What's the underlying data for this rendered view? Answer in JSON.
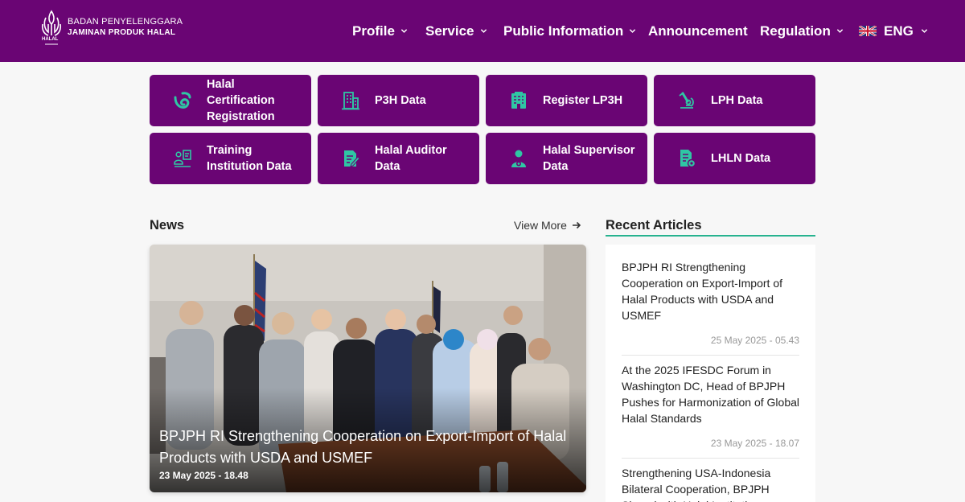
{
  "header": {
    "logo_line1": "BADAN PENYELENGGARA",
    "logo_line2": "JAMINAN PRODUK HALAL",
    "logo_small": "HALAL",
    "nav": {
      "profile": "Profile",
      "service": "Service",
      "public_information": "Public Information",
      "announcement": "Announcement",
      "regulation": "Regulation",
      "language": "ENG"
    }
  },
  "tiles": [
    {
      "label": "Halal Certification Registration",
      "icon": "halal-swirl-icon"
    },
    {
      "label": "P3H Data",
      "icon": "building-icon"
    },
    {
      "label": "Register LP3H",
      "icon": "office-building-icon"
    },
    {
      "label": "LPH Data",
      "icon": "microscope-icon"
    },
    {
      "label": "Training Institution Data",
      "icon": "presenter-icon"
    },
    {
      "label": "Halal Auditor Data",
      "icon": "document-edit-icon"
    },
    {
      "label": "Halal Supervisor Data",
      "icon": "supervisor-badge-icon"
    },
    {
      "label": "LHLN Data",
      "icon": "document-gear-icon"
    }
  ],
  "news": {
    "title": "News",
    "view_more": "View More",
    "featured": {
      "headline": "BPJPH RI Strengthening Cooperation on Export-Import of Halal Products with USDA and USMEF",
      "date": "23 May 2025 - 18.48"
    }
  },
  "recent": {
    "title": "Recent Articles",
    "articles": [
      {
        "title": "BPJPH RI Strengthening Cooperation on Export-Import of Halal Products with USDA and USMEF",
        "date": "25 May 2025 - 05.43"
      },
      {
        "title": "At the 2025 IFESDC Forum in Washington DC, Head of BPJPH Pushes for Harmonization of Global Halal Standards",
        "date": "23 May 2025 - 18.07"
      },
      {
        "title": "Strengthening USA-Indonesia Bilateral Cooperation, BPJPH Signed with Halal Institutions",
        "date": ""
      }
    ]
  },
  "colors": {
    "brand_purple": "#6a0574",
    "accent_teal": "#2fc6a4",
    "underline_green": "#27b38f"
  }
}
